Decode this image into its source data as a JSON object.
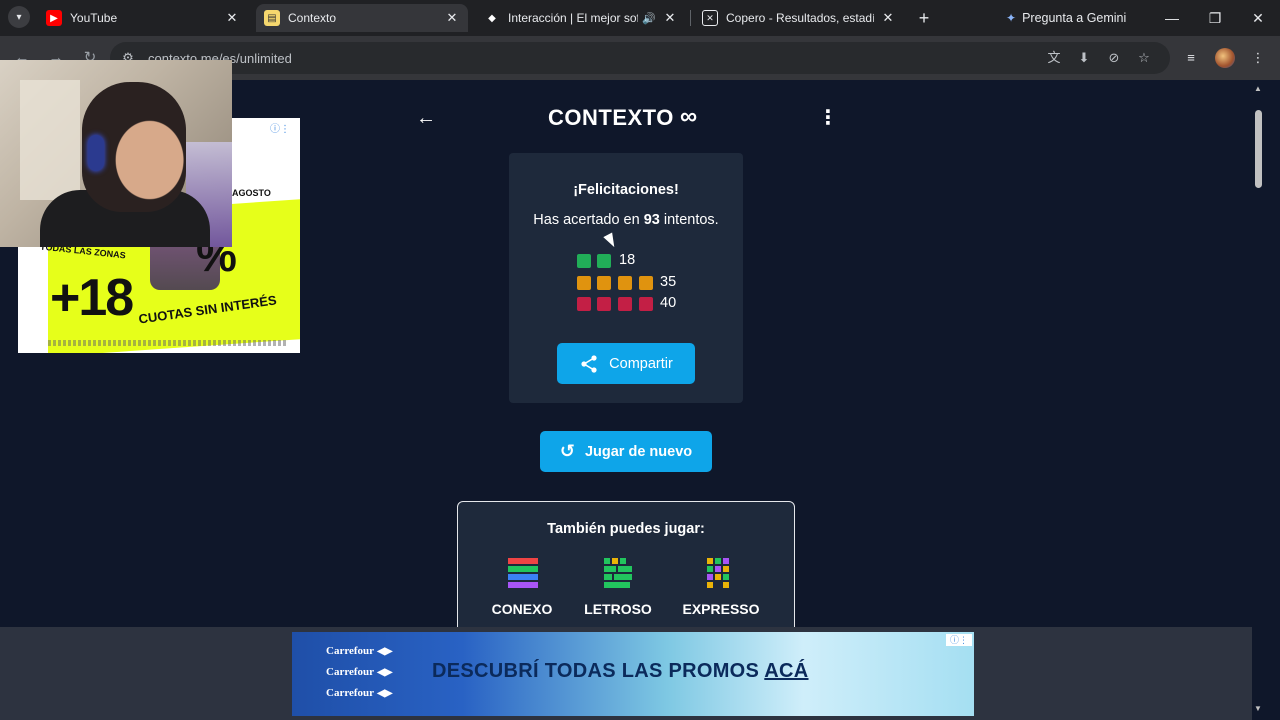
{
  "browser": {
    "tabs": [
      {
        "title": "YouTube",
        "favicon": "youtube-icon",
        "color": "#ff0000"
      },
      {
        "title": "Contexto",
        "favicon": "contexto-icon",
        "color": "#f5d76e",
        "active": true
      },
      {
        "title": "Interacción | El mejor softw",
        "favicon": "diamond-icon",
        "color": "#ffffff",
        "audio": true
      },
      {
        "title": "Copero - Resultados, estadístic",
        "favicon": "copero-icon",
        "color": "#ffffff"
      }
    ],
    "gemini_label": "Pregunta a Gemini",
    "url": "contexto.me/es/unlimited"
  },
  "header": {
    "title": "CONTEXTO",
    "infinity": "∞"
  },
  "result": {
    "congrats": "¡Felicitaciones!",
    "attempts_prefix": "Has acertado en ",
    "attempts_count": "93",
    "attempts_suffix": " intentos.",
    "rows": [
      {
        "count": "18",
        "squares": 2,
        "color": "green"
      },
      {
        "count": "35",
        "squares": 4,
        "color": "orange"
      },
      {
        "count": "40",
        "squares": 4,
        "color": "red"
      }
    ],
    "share_label": "Compartir"
  },
  "play_again_label": "Jugar de nuevo",
  "also": {
    "title": "También puedes jugar:",
    "games": [
      {
        "label": "CONEXO"
      },
      {
        "label": "LETROSO"
      },
      {
        "label": "EXPRESSO"
      }
    ]
  },
  "side_ad": {
    "month": "AGOSTO",
    "percent": "%",
    "zonas": "TODAS LAS ZONAS",
    "plus18": "+18",
    "cuotas": "CUOTAS SIN INTERÉS"
  },
  "banner": {
    "brands": [
      "Carrefour",
      "Carrefour",
      "Carrefour"
    ],
    "promo_prefix": "DESCUBRÍ TODAS LAS PROMOS ",
    "promo_emph": "ACÁ"
  },
  "colors": {
    "accent": "#0ea5e9",
    "page_bg": "#0f172a",
    "card_bg": "#1e293b"
  }
}
